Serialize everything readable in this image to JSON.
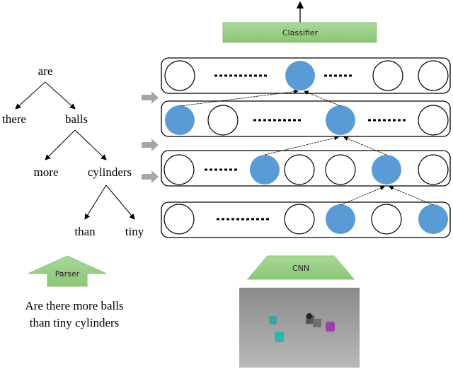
{
  "classifier": {
    "label": "Classifier",
    "color": "#9fd08a"
  },
  "parse_tree": {
    "nodes": [
      "are",
      "there",
      "balls",
      "more",
      "cylinders",
      "than",
      "tiny"
    ]
  },
  "parser": {
    "label": "Parser"
  },
  "cnn": {
    "label": "CNN"
  },
  "question": {
    "line1": "Are there more balls",
    "line2": "than tiny cylinders"
  },
  "colors": {
    "active_node": "#5b9bd5",
    "inactive_node": "#ffffff",
    "block_green": "#9fd08a",
    "side_arrow": "#a6a6a6"
  },
  "layers": [
    {
      "nodes": [
        "off",
        "dots",
        "on",
        "dots",
        "off",
        "off"
      ]
    },
    {
      "nodes": [
        "on",
        "off",
        "dots",
        "on",
        "dots",
        "off"
      ]
    },
    {
      "nodes": [
        "off",
        "dots",
        "on",
        "off",
        "off",
        "on",
        "off"
      ]
    },
    {
      "nodes": [
        "off",
        "dots",
        "off",
        "on",
        "off",
        "on"
      ]
    }
  ]
}
